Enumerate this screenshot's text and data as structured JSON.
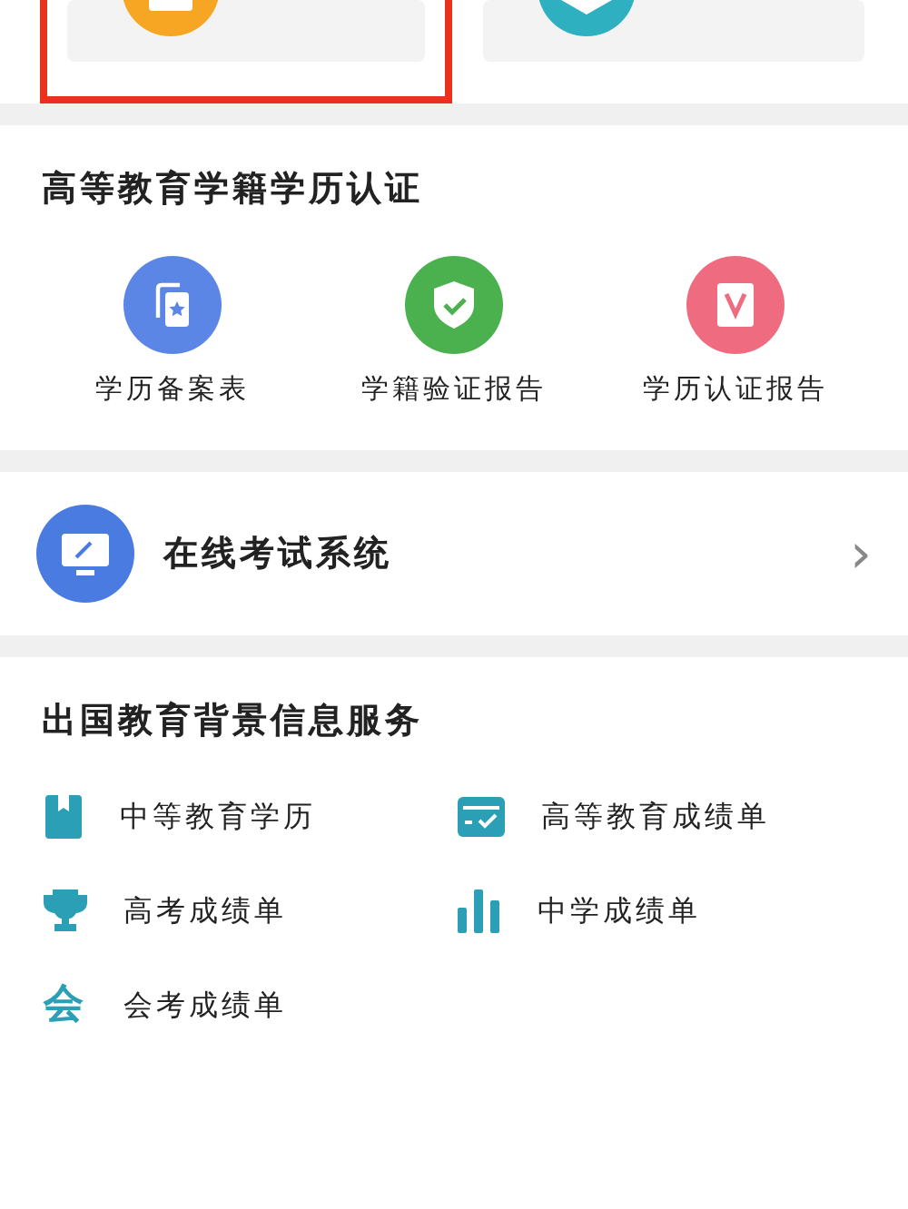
{
  "top_cards": [
    {
      "kind": "orange",
      "highlighted": true
    },
    {
      "kind": "teal",
      "highlighted": false
    }
  ],
  "certification": {
    "title": "高等教育学籍学历认证",
    "items": [
      {
        "kind": "record",
        "label": "学历备案表"
      },
      {
        "kind": "shield",
        "label": "学籍验证报告"
      },
      {
        "kind": "v",
        "label": "学历认证报告"
      }
    ]
  },
  "exam": {
    "label": "在线考试系统",
    "chevron": "›"
  },
  "abroad": {
    "title": "出国教育背景信息服务",
    "items": [
      {
        "kind": "book",
        "label": "中等教育学历"
      },
      {
        "kind": "card",
        "label": "高等教育成绩单"
      },
      {
        "kind": "trophy",
        "label": "高考成绩单"
      },
      {
        "kind": "bars",
        "label": "中学成绩单"
      },
      {
        "kind": "glyph",
        "glyph": "会",
        "label": "会考成绩单"
      }
    ]
  }
}
